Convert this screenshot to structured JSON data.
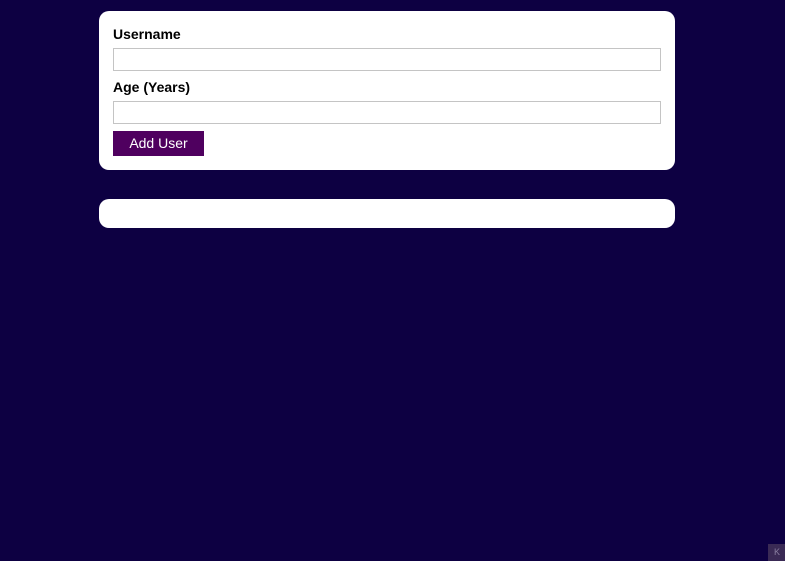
{
  "form": {
    "username_label": "Username",
    "username_value": "",
    "age_label": "Age (Years)",
    "age_value": "",
    "submit_label": "Add User"
  },
  "user_list": {
    "items": []
  },
  "corner_badge": {
    "text": "K"
  },
  "colors": {
    "page_background": "#0d0042",
    "card_background": "#ffffff",
    "button_background": "#4f005f",
    "button_text": "#ffffff",
    "input_border": "#c4c4c4"
  }
}
